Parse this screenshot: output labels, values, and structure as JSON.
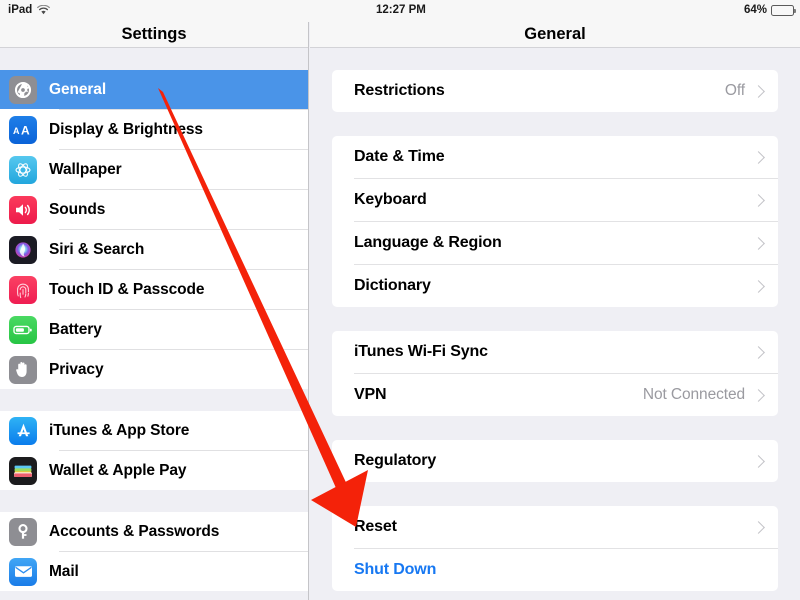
{
  "status_bar": {
    "device_label": "iPad",
    "wifi_icon": "wifi-icon",
    "time": "12:27 PM",
    "battery_percent": "64%",
    "battery_icon": "battery-icon",
    "battery_level": 64
  },
  "sidebar": {
    "title": "Settings",
    "groups": [
      {
        "items": [
          {
            "label": "General",
            "icon": "gear-icon",
            "selected": true
          },
          {
            "label": "Display & Brightness",
            "icon": "display-brightness-icon",
            "selected": false
          },
          {
            "label": "Wallpaper",
            "icon": "wallpaper-icon",
            "selected": false
          },
          {
            "label": "Sounds",
            "icon": "sounds-icon",
            "selected": false
          },
          {
            "label": "Siri & Search",
            "icon": "siri-icon",
            "selected": false
          },
          {
            "label": "Touch ID & Passcode",
            "icon": "fingerprint-icon",
            "selected": false
          },
          {
            "label": "Battery",
            "icon": "battery-settings-icon",
            "selected": false
          },
          {
            "label": "Privacy",
            "icon": "hand-privacy-icon",
            "selected": false
          }
        ]
      },
      {
        "items": [
          {
            "label": "iTunes & App Store",
            "icon": "app-store-icon",
            "selected": false
          },
          {
            "label": "Wallet & Apple Pay",
            "icon": "wallet-icon",
            "selected": false
          }
        ]
      },
      {
        "items": [
          {
            "label": "Accounts & Passwords",
            "icon": "key-icon",
            "selected": false
          },
          {
            "label": "Mail",
            "icon": "mail-icon",
            "selected": false
          }
        ]
      }
    ]
  },
  "pane": {
    "title": "General",
    "groups": [
      {
        "rows": [
          {
            "label": "Restrictions",
            "value": "Off",
            "chevron": true,
            "link": false
          }
        ]
      },
      {
        "rows": [
          {
            "label": "Date & Time",
            "value": "",
            "chevron": true,
            "link": false
          },
          {
            "label": "Keyboard",
            "value": "",
            "chevron": true,
            "link": false
          },
          {
            "label": "Language & Region",
            "value": "",
            "chevron": true,
            "link": false
          },
          {
            "label": "Dictionary",
            "value": "",
            "chevron": true,
            "link": false
          }
        ]
      },
      {
        "rows": [
          {
            "label": "iTunes Wi-Fi Sync",
            "value": "",
            "chevron": true,
            "link": false
          },
          {
            "label": "VPN",
            "value": "Not Connected",
            "chevron": true,
            "link": false
          }
        ]
      },
      {
        "rows": [
          {
            "label": "Regulatory",
            "value": "",
            "chevron": true,
            "link": false
          }
        ]
      },
      {
        "rows": [
          {
            "label": "Reset",
            "value": "",
            "chevron": true,
            "link": false
          },
          {
            "label": "Shut Down",
            "value": "",
            "chevron": false,
            "link": true
          }
        ]
      }
    ]
  },
  "annotation": {
    "arrow_color": "#f42209",
    "arrow_name": "red-annotation-arrow",
    "points_to": "Shut Down"
  },
  "colors": {
    "selection_blue": "#4a94e8",
    "link_blue": "#1778f2",
    "page_background": "#efeff4",
    "card_background": "#ffffff",
    "value_gray": "#9a9aa0"
  }
}
